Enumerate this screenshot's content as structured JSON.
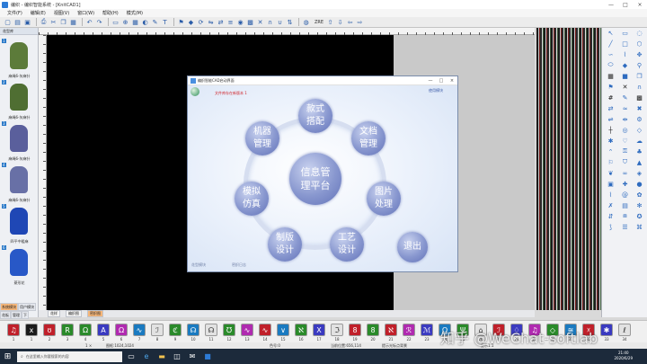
{
  "window": {
    "title": "编织 - 编织智能系统 - [KnitCAD1]",
    "controls": [
      "—",
      "□",
      "×"
    ]
  },
  "menu": [
    "文件(F)",
    "编辑(E)",
    "视图(V)",
    "窗口(W)",
    "帮助(H)",
    "模式(M)"
  ],
  "toolbar": {
    "zoom_label": "ZRE",
    "icons": [
      "new-icon",
      "open-icon",
      "save-icon",
      "print-icon",
      "cut-icon",
      "copy-icon",
      "paste-icon",
      "undo-icon",
      "redo-icon",
      "select-icon",
      "zoom-icon",
      "grid-icon",
      "fill-icon",
      "pen-icon",
      "text-icon",
      "arrow-up-icon",
      "arrow-down-icon"
    ]
  },
  "left_panel": {
    "tab": "花型库",
    "knots": [
      {
        "num": "1",
        "label": "麻绳6-灰麻针",
        "color": "#5c7b3a"
      },
      {
        "num": "2",
        "label": "麻绳6-灰麻针",
        "color": "#4f6e32"
      },
      {
        "num": "3",
        "label": "麻绳6-灰麻针",
        "color": "#5a5f9c"
      },
      {
        "num": "4",
        "label": "麻绳6-灰麻针",
        "color": "#6870a6"
      },
      {
        "num": "5",
        "label": "四平中粗麻",
        "color": "#1f47b5"
      },
      {
        "num": "6",
        "label": "菱形花",
        "color": "#2858c7"
      }
    ],
    "bottom_tabs": [
      "系统模块",
      "用户模块",
      "花板",
      "管理",
      "下"
    ]
  },
  "bottom_tabs": [
    "花样",
    "编织图",
    "密织图"
  ],
  "dialog": {
    "title": "编织智能CAD启动界面",
    "notice": "文件库存在新版本 1",
    "help": "使用模块",
    "status_left": "花型模块",
    "status_right": "密织日志",
    "center": "信息管\n理平台",
    "items": [
      {
        "id": "style",
        "text": "款式\n搭配"
      },
      {
        "id": "doc",
        "text": "文档\n管理"
      },
      {
        "id": "machine",
        "text": "机器\n管理"
      },
      {
        "id": "pattern",
        "text": "图片\n处理"
      },
      {
        "id": "simulate",
        "text": "模拟\n仿真"
      },
      {
        "id": "plate",
        "text": "制版\n设计"
      },
      {
        "id": "craft",
        "text": "工艺\n设计"
      },
      {
        "id": "exit",
        "text": "退出"
      }
    ]
  },
  "swatches": [
    {
      "num": "1",
      "color": "#c0202a",
      "glyph": "♫"
    },
    {
      "num": "1",
      "color": "#1b1b1b",
      "glyph": "x"
    },
    {
      "num": "2",
      "color": "#c0202a",
      "glyph": "ʊ"
    },
    {
      "num": "3",
      "color": "#2a8a2a",
      "glyph": "R"
    },
    {
      "num": "4",
      "color": "#2a8a2a",
      "glyph": "Ω"
    },
    {
      "num": "5",
      "color": "#3a3ac0",
      "glyph": "A"
    },
    {
      "num": "6",
      "color": "#b02ab0",
      "glyph": "Ω"
    },
    {
      "num": "7",
      "color": "#1a7ac0",
      "glyph": "∿"
    },
    {
      "num": "8",
      "color": "#e2e2e2",
      "glyph": "ℐ"
    },
    {
      "num": "9",
      "color": "#2a8a2a",
      "glyph": "ℭ"
    },
    {
      "num": "10",
      "color": "#1a7ac0",
      "glyph": "☊"
    },
    {
      "num": "11",
      "color": "#e2e2e2",
      "glyph": "☊"
    },
    {
      "num": "12",
      "color": "#2a8a2a",
      "glyph": "℧"
    },
    {
      "num": "13",
      "color": "#b02ab0",
      "glyph": "∿"
    },
    {
      "num": "14",
      "color": "#c0202a",
      "glyph": "∿"
    },
    {
      "num": "15",
      "color": "#1a7ac0",
      "glyph": "∨"
    },
    {
      "num": "16",
      "color": "#2a8a2a",
      "glyph": "ℵ"
    },
    {
      "num": "17",
      "color": "#3a3ac0",
      "glyph": "X"
    },
    {
      "num": "18",
      "color": "#e2e2e2",
      "glyph": "ℑ"
    },
    {
      "num": "19",
      "color": "#c0202a",
      "glyph": "8"
    },
    {
      "num": "20",
      "color": "#2a8a2a",
      "glyph": "8"
    },
    {
      "num": "21",
      "color": "#c0202a",
      "glyph": "ℵ"
    },
    {
      "num": "22",
      "color": "#b02ab0",
      "glyph": "ℛ"
    },
    {
      "num": "23",
      "color": "#3a3ac0",
      "glyph": "ℳ"
    },
    {
      "num": "24",
      "color": "#1a7ac0",
      "glyph": "Ω"
    },
    {
      "num": "25",
      "color": "#2a8a2a",
      "glyph": "Ψ"
    },
    {
      "num": "26",
      "color": "#e2e2e2",
      "glyph": "⌂"
    },
    {
      "num": "27",
      "color": "#c0202a",
      "glyph": "ℐ"
    },
    {
      "num": "28",
      "color": "#3a3ac0",
      "glyph": "♢"
    },
    {
      "num": "29",
      "color": "#b02ab0",
      "glyph": "♫"
    },
    {
      "num": "30",
      "color": "#2a8a2a",
      "glyph": "◇"
    },
    {
      "num": "31",
      "color": "#1a7ac0",
      "glyph": "≋"
    },
    {
      "num": "32",
      "color": "#c0202a",
      "glyph": "☓"
    },
    {
      "num": "33",
      "color": "#3a3ac0",
      "glyph": "✱"
    },
    {
      "num": "34",
      "color": "#e2e2e2",
      "glyph": "ℓ"
    }
  ],
  "status": {
    "pos": "1  ×",
    "size": "图框:1024,1024",
    "color": "色号:0",
    "coords": "当前位置:656,114",
    "hint": "提示光标点背景",
    "scale": "显示1:1"
  },
  "taskbar": {
    "search_placeholder": "在这里输入你要搜索的内容",
    "time": "21:40",
    "date": "2020/6/29"
  },
  "watermark": "知乎 @WeChat-softlab"
}
